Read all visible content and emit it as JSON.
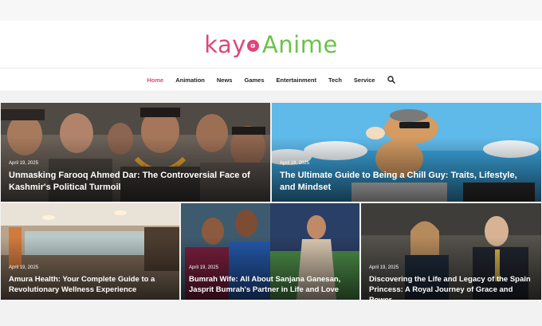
{
  "brand": {
    "logo_left": "kay",
    "logo_mark": "o",
    "logo_right": "Anime",
    "pink": "#e0457b",
    "green": "#6cc24a"
  },
  "nav": {
    "items": [
      {
        "label": "Home",
        "active": true
      },
      {
        "label": "Animation",
        "active": false
      },
      {
        "label": "News",
        "active": false
      },
      {
        "label": "Games",
        "active": false
      },
      {
        "label": "Entertainment",
        "active": false
      },
      {
        "label": "Tech",
        "active": false
      },
      {
        "label": "Service",
        "active": false
      }
    ],
    "search_icon": "search-icon"
  },
  "posts": [
    {
      "date": "April 19, 2025",
      "title": "Unmasking Farooq Ahmed Dar: The Controversial Face of Kashmir's Political Turmoil"
    },
    {
      "date": "April 19, 2025",
      "title": "The Ultimate Guide to Being a Chill Guy: Traits, Lifestyle, and Mindset"
    },
    {
      "date": "April 19, 2025",
      "title": "Amura Health: Your Complete Guide to a Revolutionary Wellness Experience"
    },
    {
      "date": "April 19, 2025",
      "title": "Bumrah Wife: All About Sanjana Ganesan, Jasprit Bumrah's Partner in Life and Love"
    },
    {
      "date": "April 19, 2025",
      "title": "Discovering the Life and Legacy of the Spain Princess: A Royal Journey of Grace and Power"
    }
  ]
}
